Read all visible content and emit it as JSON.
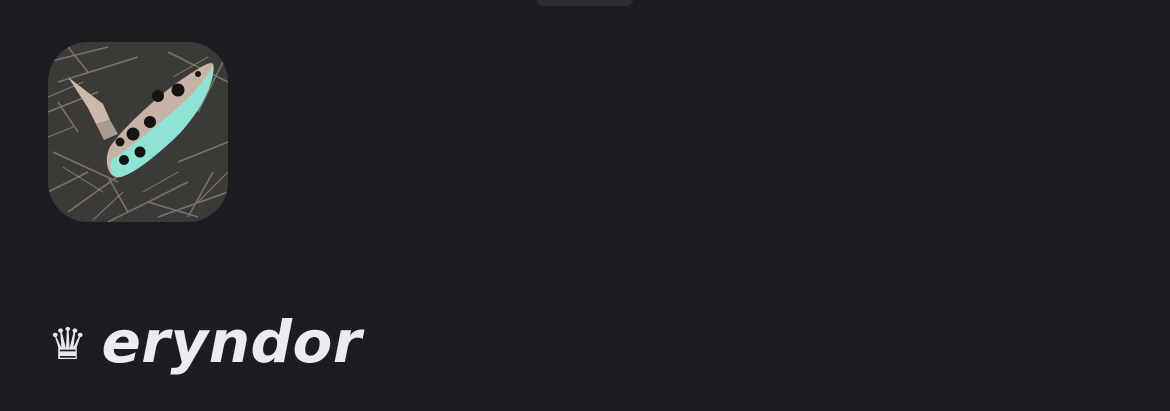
{
  "profile": {
    "avatar_icon": "ocarina-photo-avatar",
    "crown_glyph": "♛",
    "crown_icon": "crown-icon",
    "username": "eryndor"
  },
  "colors": {
    "background": "#1c1d22",
    "text": "#ececf0",
    "handle": "#2c2d33",
    "ocarina_accent": "#8fe3d6"
  }
}
